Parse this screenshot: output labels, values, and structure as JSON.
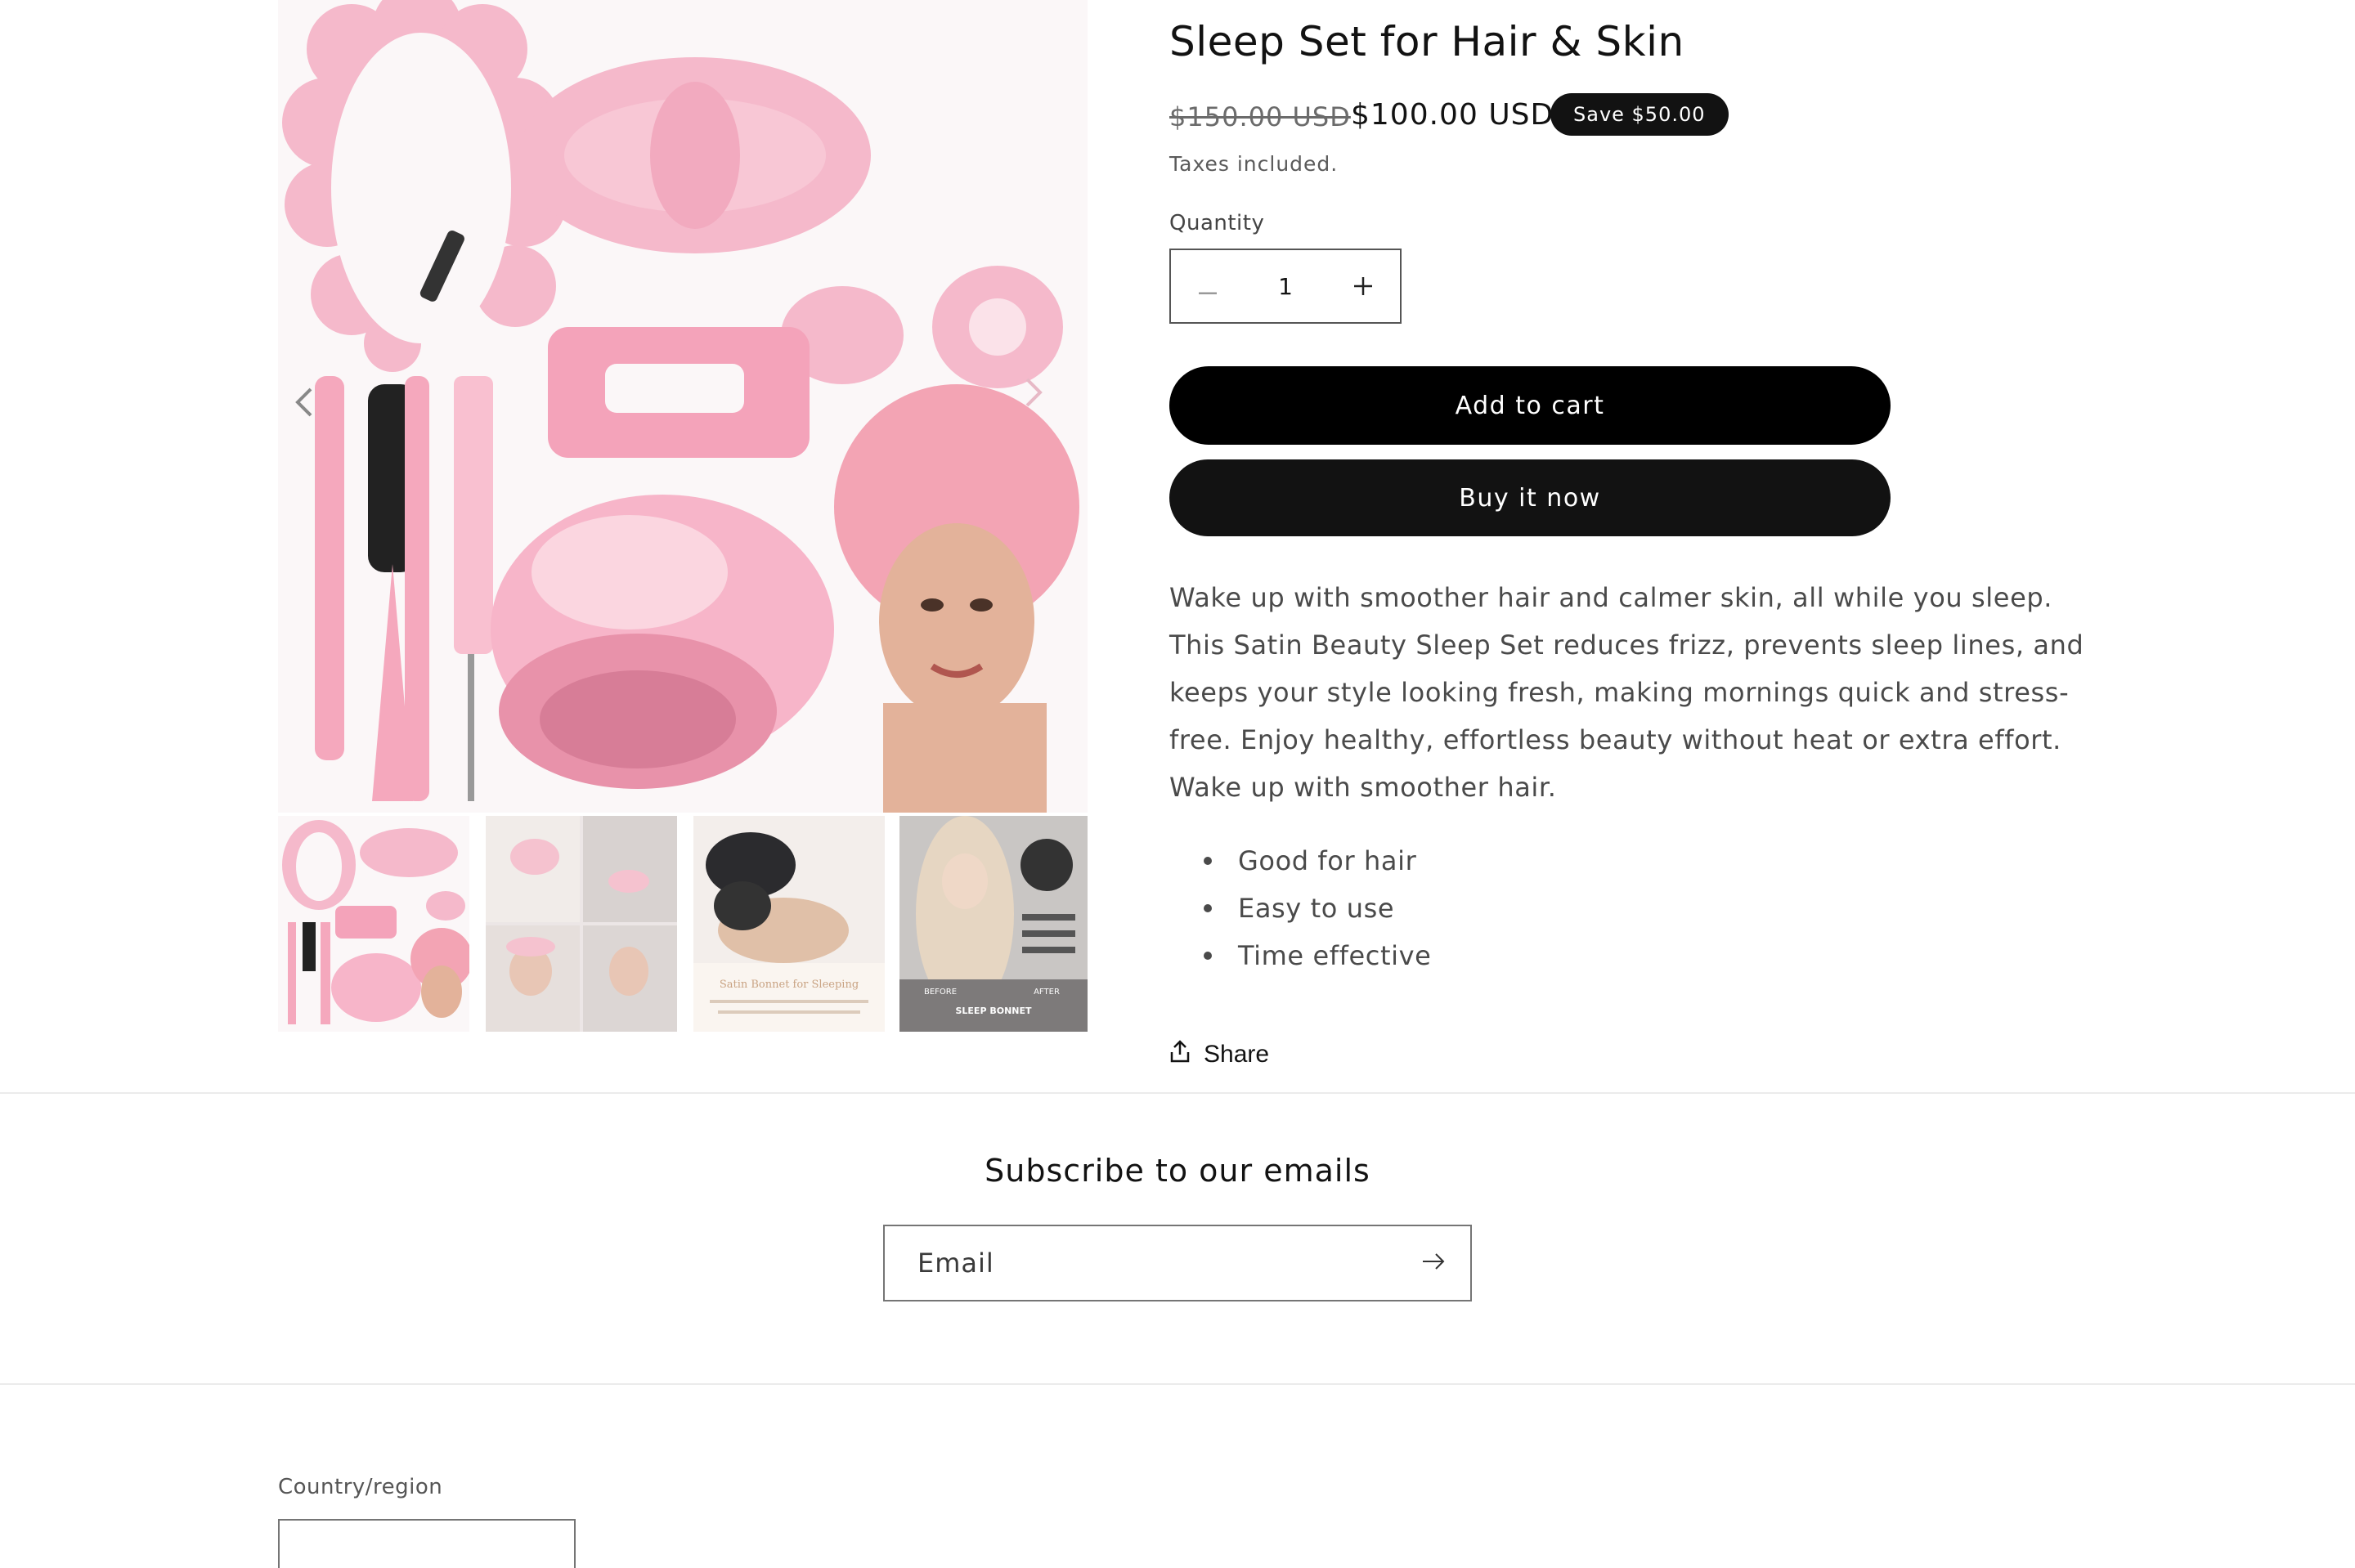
{
  "product": {
    "title": "Sleep Set for Hair & Skin",
    "price_compare": "$150.00 USD",
    "price_sale": "$100.00 USD",
    "save_badge": "Save $50.00",
    "taxes_note": "Taxes included.",
    "quantity_label": "Quantity",
    "quantity_value": "1",
    "add_to_cart_label": "Add to cart",
    "buy_now_label": "Buy it now",
    "description": [
      "Wake up with smoother hair and calmer skin, all while you sleep. This Satin Beauty Sleep Set reduces frizz, prevents sleep lines, and keeps your style looking fresh, making mornings quick and stress-free. Enjoy healthy, effortless beauty without heat or extra effort.",
      "Wake up with smoother hair."
    ],
    "features": [
      "Good for hair",
      "Easy to use",
      "Time effective"
    ],
    "share_label": "Share"
  },
  "gallery": {
    "thumb2_caption": "Satin Bonnet for Sleeping",
    "thumb3_before": "BEFORE",
    "thumb3_after": "AFTER",
    "thumb3_caption": "SLEEP BONNET"
  },
  "newsletter": {
    "title": "Subscribe to our emails",
    "email_placeholder": "Email"
  },
  "footer": {
    "country_label": "Country/region"
  },
  "icons": {
    "minus": "minus-icon",
    "plus": "plus-icon",
    "share": "share-icon",
    "submit": "arrow-right-icon",
    "prev": "chevron-left-icon",
    "next": "chevron-right-icon"
  },
  "colors": {
    "primary_button": "#121212",
    "badge_bg": "#121212",
    "product_pink": "#f4b6c8"
  }
}
